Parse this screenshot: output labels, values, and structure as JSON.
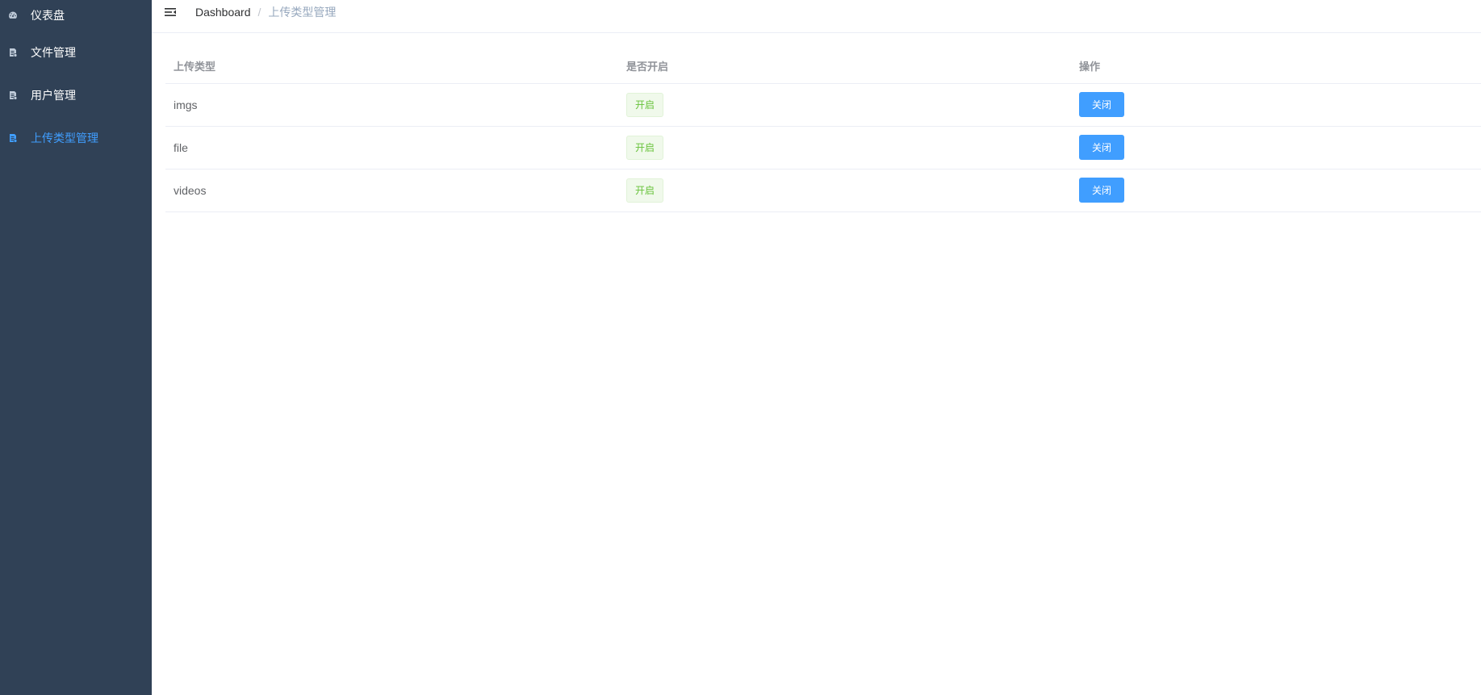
{
  "sidebar": {
    "items": [
      {
        "label": "仪表盘",
        "icon": "dashboard-icon",
        "active": false
      },
      {
        "label": "文件管理",
        "icon": "document-icon",
        "active": false
      },
      {
        "label": "用户管理",
        "icon": "document-icon",
        "active": false
      },
      {
        "label": "上传类型管理",
        "icon": "document-icon",
        "active": true
      }
    ]
  },
  "navbar": {
    "icon": "hamburger-icon",
    "breadcrumb": {
      "home": "Dashboard",
      "separator": "/",
      "current": "上传类型管理"
    }
  },
  "table": {
    "headers": [
      "上传类型",
      "是否开启",
      "操作"
    ],
    "rows": [
      {
        "type": "imgs",
        "status": "开启",
        "action": "关闭"
      },
      {
        "type": "file",
        "status": "开启",
        "action": "关闭"
      },
      {
        "type": "videos",
        "status": "开启",
        "action": "关闭"
      }
    ]
  },
  "colors": {
    "sidebar_bg": "#304156",
    "active": "#409eff",
    "success": "#67c23a"
  }
}
